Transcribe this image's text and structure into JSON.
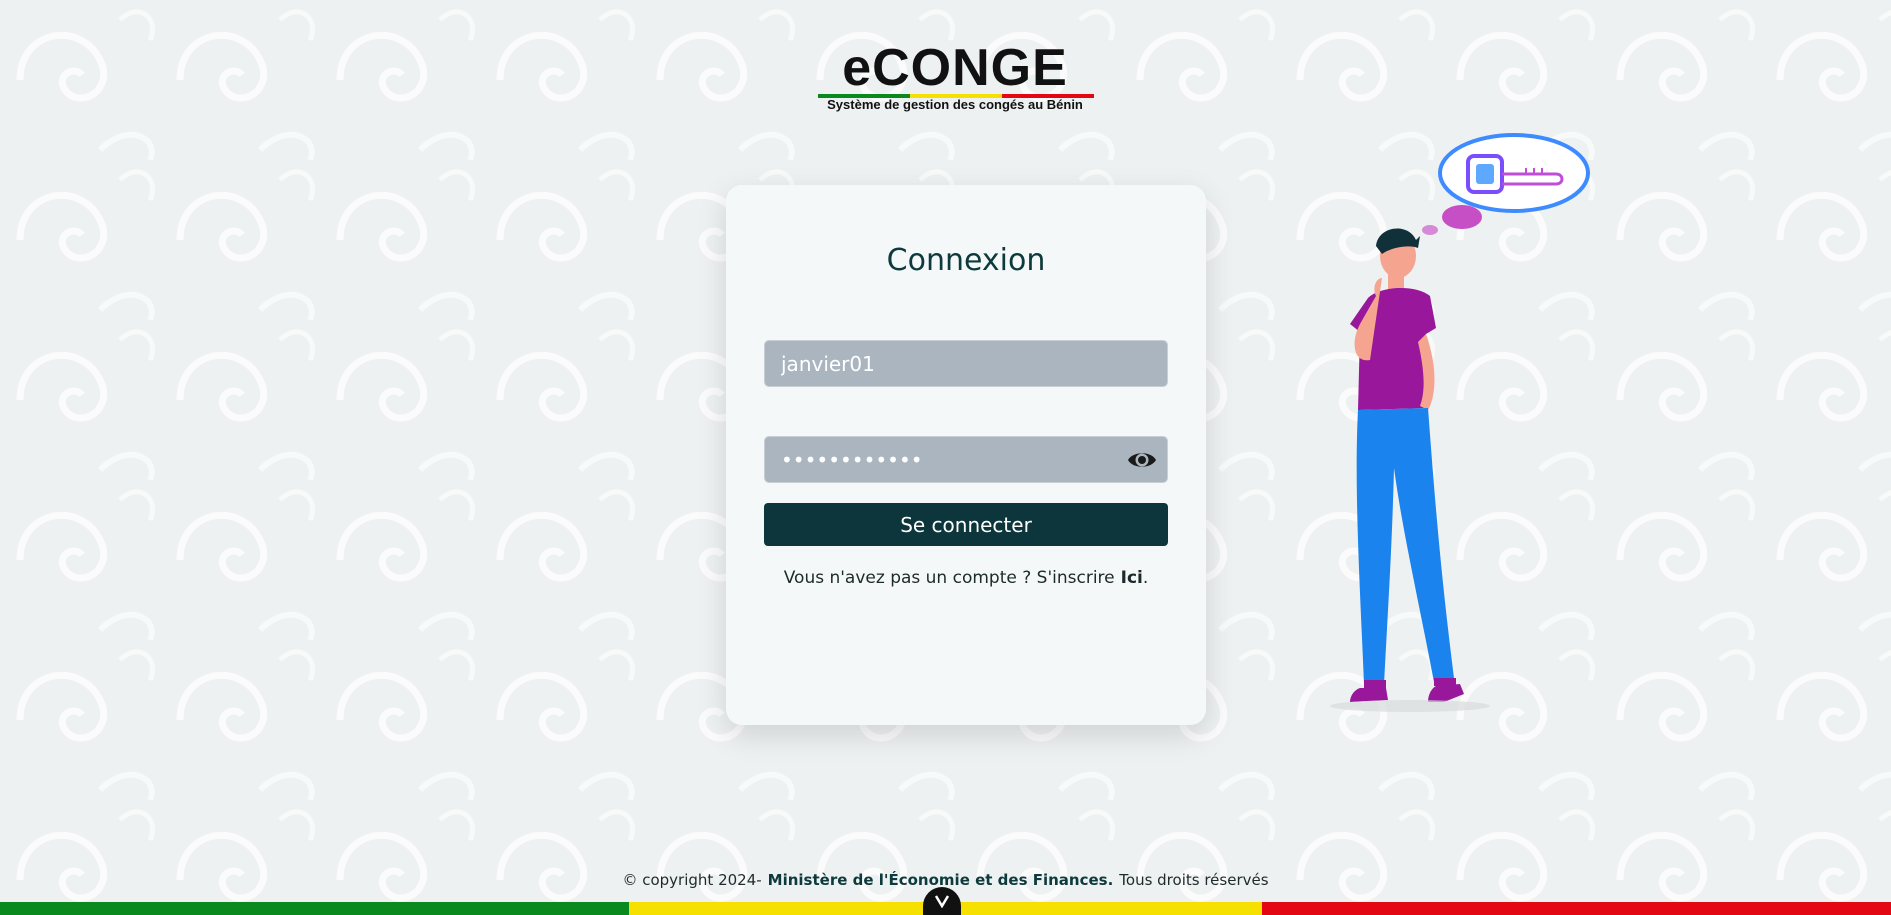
{
  "brand": {
    "logo_text": "eCONGE",
    "tagline": "Système de gestion des congés au Bénin",
    "flag_colors": [
      "#0a8a1e",
      "#f6e000",
      "#e30613"
    ]
  },
  "login": {
    "title": "Connexion",
    "username_value": "janvier01",
    "password_value": "••••••••••••",
    "password_toggle_icon": "eye-icon",
    "submit_label": "Se connecter",
    "signup_prompt": "Vous n'avez pas un compte ? S'inscrire",
    "signup_link": "Ici",
    "signup_suffix": "."
  },
  "footer": {
    "copyright": "© copyright 2024-",
    "ministry": "Ministère de l'Économie et des Finances.",
    "rights": "Tous droits réservés",
    "scroll_icon": "chevron-down-icon"
  },
  "colors": {
    "primary": "#0c363b",
    "input_bg": "#abb5c0",
    "flag_green": "#0a8a1e",
    "flag_yellow": "#f6e000",
    "flag_red": "#e30613"
  }
}
